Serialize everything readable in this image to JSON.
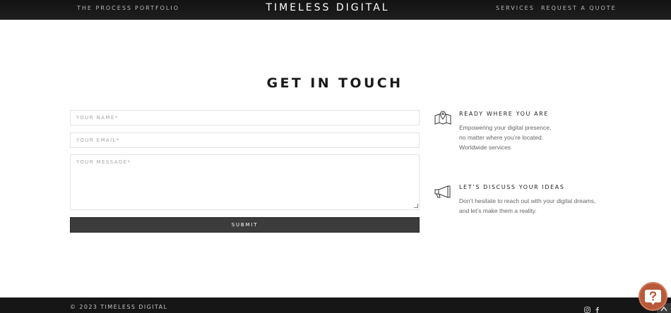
{
  "nav": {
    "left": [
      "THE PROCESS",
      "PORTFOLIO"
    ],
    "brand": "TIMELESS DIGITAL",
    "right": [
      "SERVICES",
      "REQUEST A QUOTE"
    ]
  },
  "contact": {
    "heading": "GET IN TOUCH",
    "form": {
      "name_placeholder": "YOUR NAME*",
      "email_placeholder": "YOUR EMAIL*",
      "message_placeholder": "YOUR MESSAGE*",
      "name_value": "",
      "email_value": "",
      "message_value": "",
      "submit_label": "SUBMIT"
    },
    "info": [
      {
        "icon": "map-pin-icon",
        "title": "READY WHERE YOU ARE",
        "lines": [
          "Empowering your digital presence,",
          "no matter where you’re located.",
          "Worldwide services"
        ]
      },
      {
        "icon": "megaphone-icon",
        "title": "LET’S DISCUSS YOUR IDEAS",
        "lines": [
          "Don’t hesitate to reach out with your digital dreams,",
          "and let’s make them a reality."
        ]
      }
    ]
  },
  "footer": {
    "copyright": "© 2023 TIMELESS DIGITAL",
    "social": [
      "instagram-icon",
      "facebook-icon"
    ]
  },
  "widgets": {
    "help_icon": "question-bubble-icon",
    "back_to_top_icon": "chevron-up-icon",
    "help_color": "#b8593a"
  }
}
